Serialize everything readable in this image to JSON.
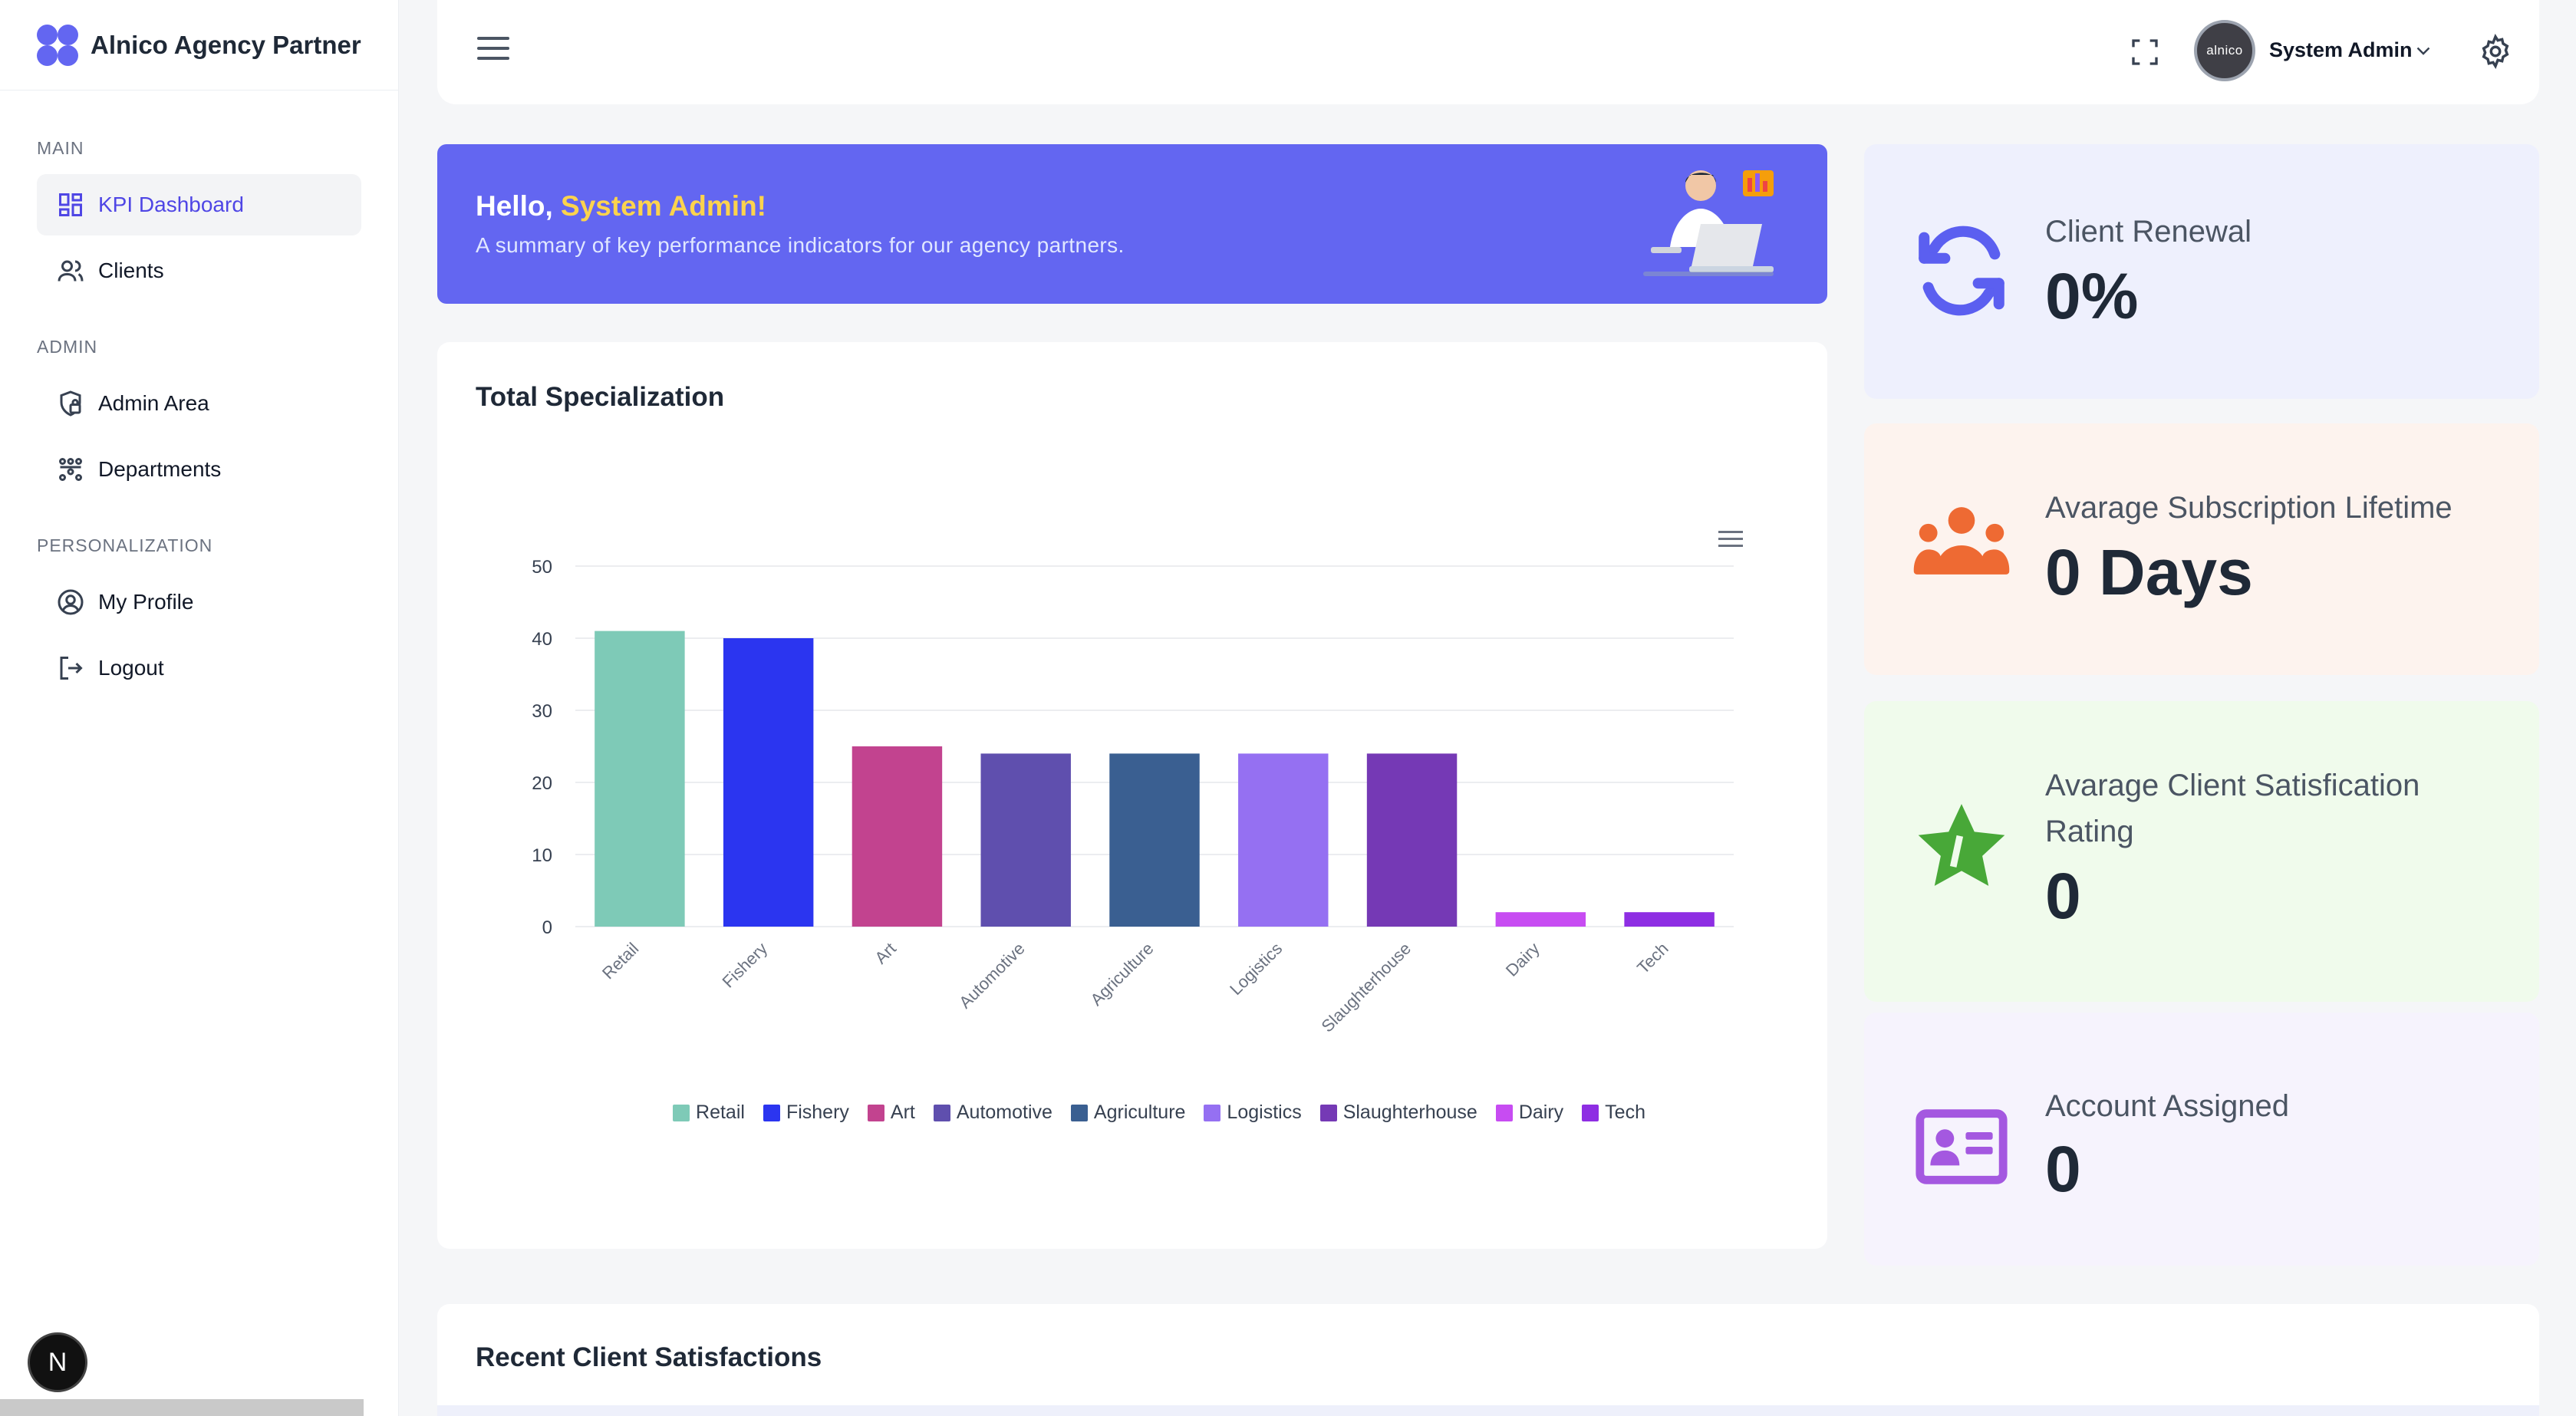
{
  "app": {
    "title": "Alnico Agency Partner"
  },
  "sidebar": {
    "sections": [
      {
        "heading": "MAIN",
        "items": [
          {
            "label": "KPI Dashboard",
            "icon": "dashboard-icon",
            "active": true
          },
          {
            "label": "Clients",
            "icon": "users-icon",
            "active": false
          }
        ]
      },
      {
        "heading": "ADMIN",
        "items": [
          {
            "label": "Admin Area",
            "icon": "shield-lock-icon",
            "active": false
          },
          {
            "label": "Departments",
            "icon": "org-chart-icon",
            "active": false
          }
        ]
      },
      {
        "heading": "PERSONALIZATION",
        "items": [
          {
            "label": "My Profile",
            "icon": "user-circle-icon",
            "active": false
          },
          {
            "label": "Logout",
            "icon": "logout-icon",
            "active": false
          }
        ]
      }
    ],
    "badge_letter": "N"
  },
  "header": {
    "avatar_text": "alnico",
    "user_name": "System Admin"
  },
  "banner": {
    "greeting": "Hello,",
    "name": "System Admin!",
    "subtitle": "A summary of key performance indicators for our agency partners."
  },
  "chart_card": {
    "title": "Total Specialization"
  },
  "chart_data": {
    "type": "bar",
    "categories": [
      "Retail",
      "Fishery",
      "Art",
      "Automotive",
      "Agriculture",
      "Logistics",
      "Slaughterhouse",
      "Dairy",
      "Tech"
    ],
    "values": [
      41,
      40,
      25,
      24,
      24,
      24,
      24,
      2,
      2
    ],
    "colors": [
      "#7ecab7",
      "#2b35f0",
      "#c2438f",
      "#5f4fae",
      "#3a5f91",
      "#9570f2",
      "#7539b5",
      "#c74cf2",
      "#8e2ee3"
    ],
    "ylim": [
      0,
      50
    ],
    "yticks": [
      0,
      10,
      20,
      30,
      40,
      50
    ],
    "title": "Total Specialization",
    "xlabel": "",
    "ylabel": "",
    "grid": true,
    "legend": "bottom"
  },
  "kpis": [
    {
      "label": "Client Renewal",
      "value": "0%",
      "icon": "refresh-icon",
      "bg": "#eef0fd",
      "color": "#5b5ff0"
    },
    {
      "label": "Avarage Subscription Lifetime",
      "value": "0 Days",
      "icon": "group-icon",
      "bg": "#fdf3ee",
      "color": "#ee6a33"
    },
    {
      "label": "Avarage Client Satisfication Rating",
      "value": "0",
      "icon": "star-icon",
      "bg": "#f0fbec",
      "color": "#48a838"
    },
    {
      "label": "Account Assigned",
      "value": "0",
      "icon": "id-card-icon",
      "bg": "#f6f3fd",
      "color": "#a458e0"
    }
  ],
  "recent": {
    "title": "Recent Client Satisfactions"
  }
}
